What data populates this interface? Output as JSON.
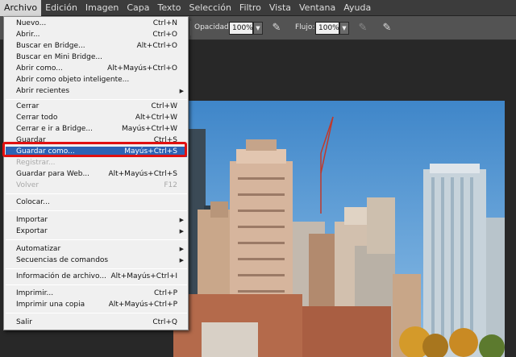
{
  "menubar": {
    "items": [
      "Archivo",
      "Edición",
      "Imagen",
      "Capa",
      "Texto",
      "Selección",
      "Filtro",
      "Vista",
      "Ventana",
      "Ayuda"
    ]
  },
  "options": {
    "opacity_label": "Opacidad:",
    "opacity_value": "100%",
    "flow_label": "Flujo:",
    "flow_value": "100%"
  },
  "file_menu": {
    "items": [
      {
        "label": "Nuevo...",
        "shortcut": "Ctrl+N"
      },
      {
        "label": "Abrir...",
        "shortcut": "Ctrl+O"
      },
      {
        "label": "Buscar en Bridge...",
        "shortcut": "Alt+Ctrl+O"
      },
      {
        "label": "Buscar en Mini Bridge...",
        "shortcut": ""
      },
      {
        "label": "Abrir como...",
        "shortcut": "Alt+Mayús+Ctrl+O"
      },
      {
        "label": "Abrir como objeto inteligente...",
        "shortcut": ""
      },
      {
        "label": "Abrir recientes",
        "shortcut": ""
      },
      {
        "label": "Cerrar",
        "shortcut": "Ctrl+W"
      },
      {
        "label": "Cerrar todo",
        "shortcut": "Alt+Ctrl+W"
      },
      {
        "label": "Cerrar e ir a Bridge...",
        "shortcut": "Mayús+Ctrl+W"
      },
      {
        "label": "Guardar",
        "shortcut": "Ctrl+S"
      },
      {
        "label": "Guardar como...",
        "shortcut": "Mayús+Ctrl+S"
      },
      {
        "label": "Registrar...",
        "shortcut": ""
      },
      {
        "label": "Guardar para Web...",
        "shortcut": "Alt+Mayús+Ctrl+S"
      },
      {
        "label": "Volver",
        "shortcut": "F12"
      },
      {
        "label": "Colocar...",
        "shortcut": ""
      },
      {
        "label": "Importar",
        "shortcut": ""
      },
      {
        "label": "Exportar",
        "shortcut": ""
      },
      {
        "label": "Automatizar",
        "shortcut": ""
      },
      {
        "label": "Secuencias de comandos",
        "shortcut": ""
      },
      {
        "label": "Información de archivo...",
        "shortcut": "Alt+Mayús+Ctrl+I"
      },
      {
        "label": "Imprimir...",
        "shortcut": "Ctrl+P"
      },
      {
        "label": "Imprimir una copia",
        "shortcut": "Alt+Mayús+Ctrl+P"
      },
      {
        "label": "Salir",
        "shortcut": "Ctrl+Q"
      }
    ]
  },
  "colors": {
    "highlight": "#2e63b4",
    "annotation_box": "#e01010"
  }
}
